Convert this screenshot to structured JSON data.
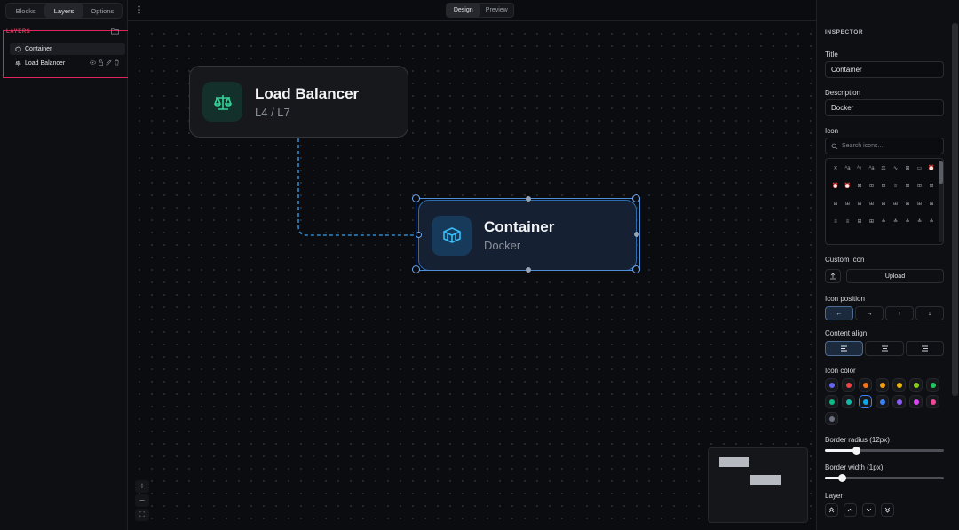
{
  "left_panel": {
    "tabs": [
      {
        "label": "Blocks",
        "active": false
      },
      {
        "label": "Layers",
        "active": true
      },
      {
        "label": "Options",
        "active": false
      }
    ],
    "section_title": "LAYERS",
    "layers": [
      {
        "label": "Container",
        "selected": true
      },
      {
        "label": "Load Balancer",
        "selected": false
      }
    ]
  },
  "topbar": {
    "modes": [
      {
        "label": "Design",
        "active": true
      },
      {
        "label": "Preview",
        "active": false
      }
    ]
  },
  "canvas": {
    "nodes": [
      {
        "id": "lb",
        "title": "Load Balancer",
        "subtitle": "L4 / L7",
        "icon": "scale-icon",
        "color": "#34d399"
      },
      {
        "id": "ct",
        "title": "Container",
        "subtitle": "Docker",
        "icon": "container-icon",
        "color": "#38bdf8"
      }
    ],
    "zoom_controls": [
      "+",
      "−",
      "⛶"
    ]
  },
  "inspector": {
    "header": "INSPECTOR",
    "title_label": "Title",
    "title_value": "Container",
    "description_label": "Description",
    "description_value": "Docker",
    "icon_label": "Icon",
    "icon_search_placeholder": "Search icons...",
    "custom_icon_label": "Custom icon",
    "upload_label": "Upload",
    "icon_position_label": "Icon position",
    "icon_positions": [
      "←",
      "→",
      "↑",
      "↓"
    ],
    "content_align_label": "Content align",
    "content_aligns": [
      "left",
      "center",
      "right"
    ],
    "icon_color_label": "Icon color",
    "icon_colors": [
      "#6366f1",
      "#ef4444",
      "#f97316",
      "#f59e0b",
      "#eab308",
      "#84cc16",
      "#22c55e",
      "#10b981",
      "#14b8a6",
      "#0ea5e9",
      "#3b82f6",
      "#8b5cf6",
      "#d946ef",
      "#ec4899",
      "#6b7280"
    ],
    "selected_color_index": 9,
    "border_radius_label": "Border radius (12px)",
    "border_radius_fraction": 0.26,
    "border_width_label": "Border width (1px)",
    "border_width_fraction": 0.14,
    "layer_label": "Layer"
  }
}
